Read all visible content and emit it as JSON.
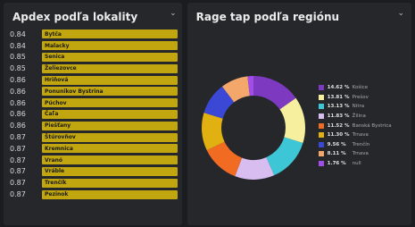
{
  "left_panel": {
    "title": "Apdex podľa lokality",
    "menu_icon": "chevron-down-icon",
    "bar_color": "#c2a60f",
    "rows": [
      {
        "value": "0.84",
        "label": "Bytča"
      },
      {
        "value": "0.84",
        "label": "Malacky"
      },
      {
        "value": "0.85",
        "label": "Senica"
      },
      {
        "value": "0.85",
        "label": "Želiezovce"
      },
      {
        "value": "0.86",
        "label": "Hriňová"
      },
      {
        "value": "0.86",
        "label": "Ponunikov Bystrina"
      },
      {
        "value": "0.86",
        "label": "Púchov"
      },
      {
        "value": "0.86",
        "label": "Čaľa"
      },
      {
        "value": "0.86",
        "label": "Piešťany"
      },
      {
        "value": "0.87",
        "label": "Štúrovňov"
      },
      {
        "value": "0.87",
        "label": "Kremnica"
      },
      {
        "value": "0.87",
        "label": "Vranó"
      },
      {
        "value": "0.87",
        "label": "Vráble"
      },
      {
        "value": "0.87",
        "label": "Trenčík"
      },
      {
        "value": "0.87",
        "label": "Pezinok"
      }
    ]
  },
  "right_panel": {
    "title": "Rage tap podľa regiónu",
    "menu_icon": "chevron-down-icon",
    "chart_data": {
      "type": "pie",
      "title": "Rage tap podľa regiónu",
      "hole": 0.62,
      "slices": [
        {
          "name": "Košice",
          "pct_label": "14.62 %",
          "value": 14.62,
          "color": "#7d3ac1"
        },
        {
          "name": "Prešov",
          "pct_label": "13.81 %",
          "value": 13.81,
          "color": "#f6ef9e"
        },
        {
          "name": "Nitra",
          "pct_label": "13.13 %",
          "value": 13.13,
          "color": "#3dc6d6"
        },
        {
          "name": "Žilina",
          "pct_label": "11.83 %",
          "value": 11.83,
          "color": "#d7bdf0"
        },
        {
          "name": "Banská Bystrica",
          "pct_label": "11.52 %",
          "value": 11.52,
          "color": "#f26b22"
        },
        {
          "name": "Trnava",
          "pct_label": "11.30 %",
          "value": 11.3,
          "color": "#e0b111"
        },
        {
          "name": "Trenčín",
          "pct_label": "9.56 %",
          "value": 9.56,
          "color": "#3b48d6"
        },
        {
          "name": "Trnava",
          "pct_label": "8.11 %",
          "value": 8.11,
          "color": "#f4a76b"
        },
        {
          "name": "null",
          "pct_label": "1.76 %",
          "value": 1.76,
          "color": "#a14de8"
        }
      ]
    }
  }
}
